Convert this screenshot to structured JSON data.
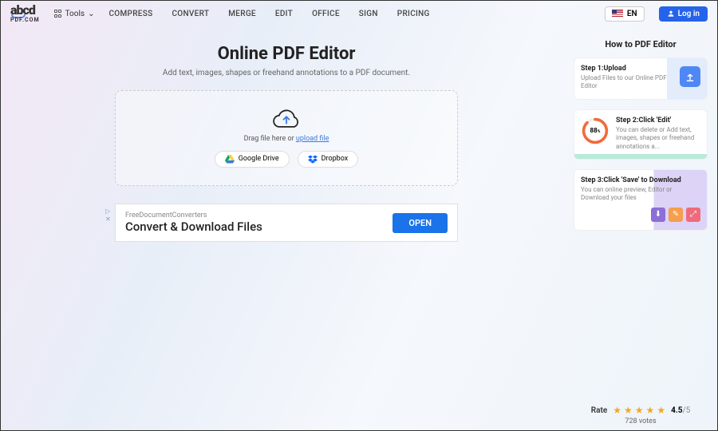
{
  "logo": {
    "text": "abcd",
    "sub": "PDF.COM"
  },
  "tools_label": "Tools",
  "nav": [
    "COMPRESS",
    "CONVERT",
    "MERGE",
    "EDIT",
    "OFFICE",
    "SIGN",
    "PRICING"
  ],
  "lang": "EN",
  "login": "Log in",
  "main": {
    "title": "Online PDF Editor",
    "subtitle": "Add text, images, shapes or freehand annotations to a PDF document.",
    "drag_prefix": "Drag file here or ",
    "drag_link": "upload file",
    "gdrive": "Google Drive",
    "dropbox": "Dropbox"
  },
  "ad": {
    "brand": "FreeDocumentConverters",
    "headline": "Convert & Download Files",
    "cta": "OPEN"
  },
  "sidebar": {
    "title": "How to PDF Editor",
    "step1": {
      "label": "Step 1:Upload",
      "desc": "Upload Files to our Online PDF Editor"
    },
    "step2": {
      "label": "Step 2:Click 'Edit'",
      "desc": "You can delete or Add text, images, shapes or freehand annotations a...",
      "gauge": "88",
      "gauge_unit": "%"
    },
    "step3": {
      "label": "Step 3:Click 'Save' to Download",
      "desc": "You can online preview, Editor or Download your files"
    }
  },
  "rating": {
    "label": "Rate",
    "score": "4.5",
    "out_of": "/5",
    "votes_count": "728",
    "votes_word": "votes"
  }
}
